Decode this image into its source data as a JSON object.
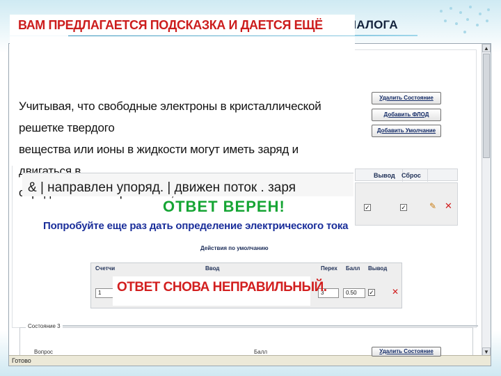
{
  "slide": {
    "title": "ФРАГМЕНТ СЦЕНАРИЯ ОБУЧАЮЩЕГО ДИАЛОГА"
  },
  "hint": {
    "header": "ВАМ ПРЕДЛАГАЕТСЯ ПОДСКАЗКА И ДАЕТСЯ ЕЩЁ ОДНА ПОПЫТКА",
    "lines": [
      "Учитывая, что свободные электроны в кристаллической решетке твердого",
      "вещества или ионы в жидкости могут иметь заряд и двигаться в",
      "определенном направлении,"
    ]
  },
  "buttons": {
    "delete_state": "Удалить Состояние",
    "add_flod": "Добавить ФЛОД",
    "add_default": "Добавить Умолчание"
  },
  "grid": {
    "headers": [
      "Вывод",
      "Сброс"
    ]
  },
  "answer": {
    "text": "& | направлен упоряд. | движен поток . заря"
  },
  "feedback": {
    "correct": "ОТВЕТ ВЕРЕН!",
    "retry": "Попробуйте еще раз дать определение электрического тока",
    "incorrect_again": "ОТВЕТ СНОВА НЕПРАВИЛЬНЫЙ."
  },
  "defaults": {
    "section_label": "Действия по умолчанию",
    "headers": [
      "Счетчи",
      "Ввод",
      "Перех",
      "Балл",
      "Вывод"
    ],
    "counter": "1",
    "transition": "3",
    "score": "0.50"
  },
  "state3": {
    "legend": "Состояние 3",
    "question_label": "Вопрос",
    "score_label": "Балл"
  },
  "status": {
    "text": "Готово"
  },
  "colors": {
    "header_red": "#cc1d1d",
    "ok_green": "#16a534",
    "retry_blue": "#1a2e9a",
    "button_text": "#122a66"
  }
}
